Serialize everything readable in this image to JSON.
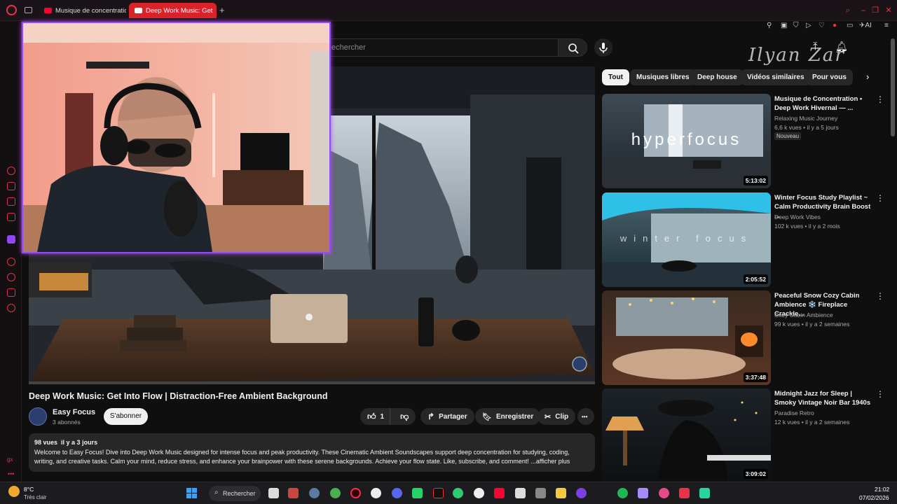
{
  "browser": {
    "tabs": [
      {
        "label": "Musique de concentration"
      },
      {
        "label": "Deep Work Music: Get"
      }
    ],
    "new_tab_label": "+"
  },
  "youtube": {
    "search": {
      "placeholder": "echercher"
    },
    "watermark": "Ilyan Zar"
  },
  "video": {
    "title": "Deep Work Music: Get Into Flow | Distraction-Free Ambient Background",
    "channel": "Easy Focus",
    "subscribers": "3 abonnés",
    "subscribe_label": "S'abonner",
    "like_count": "1",
    "share_label": "Partager",
    "save_label": "Enregistrer",
    "clip_label": "Clip",
    "more_label": "•••",
    "description": {
      "views": "98 vues",
      "date": "il y a 3 jours",
      "text": "Welcome to Easy Focus! Dive into Deep Work Music designed for intense focus and peak productivity. These Cinematic Ambient Soundscapes support deep concentration for studying, coding, writing, and creative tasks. Calm your mind, reduce stress, and enhance your brainpower with these serene backgrounds. Achieve your flow state. Like, subscribe, and comment! ...afficher plus"
    }
  },
  "chips": [
    "Tout",
    "Musiques libres",
    "Deep house",
    "Vidéos similaires",
    "Pour vous"
  ],
  "recommended": [
    {
      "title": "Musique de Concentration • Deep Work Hivernal — ...",
      "channel": "Relaxing Music Journey",
      "meta": "6,6 k vues • il y a 5 jours",
      "badge": "Nouveau",
      "duration": "5:13:02",
      "overlay": "hyperfocus"
    },
    {
      "title": "Winter Focus Study Playlist ~ Calm Productivity Brain Boost ...",
      "channel": "Deep Work Vibes",
      "meta": "102 k vues • il y a 2 mois",
      "duration": "2:05:52",
      "overlay": "winter focus"
    },
    {
      "title": "Peaceful Snow Cozy Cabin Ambience ❄️ Fireplace Crackle...",
      "channel": "Cozy Cabin Ambience",
      "meta": "99 k vues • il y a 2 semaines",
      "duration": "3:37:48"
    },
    {
      "title": "Midnight Jazz for Sleep | Smoky Vintage Noir Bar 1940s",
      "channel": "Paradise Retro",
      "meta": "12 k vues • il y a 2 semaines",
      "duration": "3:09:02"
    }
  ],
  "taskbar": {
    "weather_temp": "8°C",
    "weather_desc": "Très clair",
    "search_label": "Rechercher",
    "time": "21:02",
    "date": "07/02/2026"
  }
}
